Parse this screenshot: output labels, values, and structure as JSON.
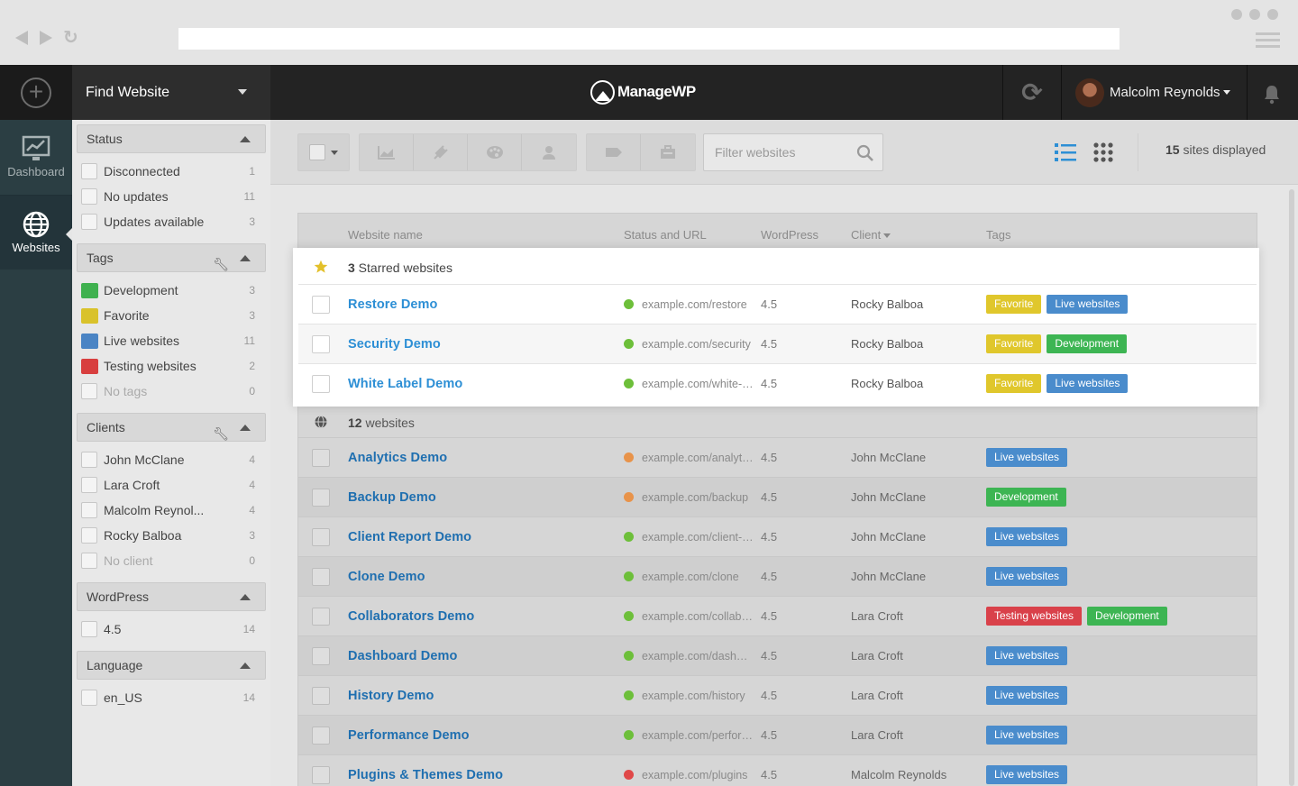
{
  "topbar": {
    "find_website": "Find Website",
    "logo_text": "ManageWP",
    "user_name": "Malcolm Reynolds"
  },
  "leftnav": {
    "dashboard_label": "Dashboard",
    "websites_label": "Websites"
  },
  "sidebar": {
    "status": {
      "title": "Status",
      "items": [
        {
          "label": "Disconnected",
          "count": "1"
        },
        {
          "label": "No updates",
          "count": "11"
        },
        {
          "label": "Updates available",
          "count": "3"
        }
      ]
    },
    "tags": {
      "title": "Tags",
      "items": [
        {
          "label": "Development",
          "count": "3",
          "color": "#3fb14f"
        },
        {
          "label": "Favorite",
          "count": "3",
          "color": "#d9c22b"
        },
        {
          "label": "Live websites",
          "count": "11",
          "color": "#4a84c4"
        },
        {
          "label": "Testing websites",
          "count": "2",
          "color": "#d83f3f"
        },
        {
          "label": "No tags",
          "count": "0"
        }
      ]
    },
    "clients": {
      "title": "Clients",
      "items": [
        {
          "label": "John McClane",
          "count": "4"
        },
        {
          "label": "Lara Croft",
          "count": "4"
        },
        {
          "label": "Malcolm Reynol...",
          "count": "4"
        },
        {
          "label": "Rocky Balboa",
          "count": "3"
        },
        {
          "label": "No client",
          "count": "0"
        }
      ]
    },
    "wordpress": {
      "title": "WordPress",
      "items": [
        {
          "label": "4.5",
          "count": "14"
        }
      ]
    },
    "language": {
      "title": "Language",
      "items": [
        {
          "label": "en_US",
          "count": "14"
        }
      ]
    }
  },
  "toolbar": {
    "filter_placeholder": "Filter websites",
    "sites_count": "15",
    "sites_count_suffix": " sites displayed"
  },
  "table": {
    "headers": {
      "name": "Website name",
      "status": "Status and URL",
      "wordpress": "WordPress",
      "client": "Client",
      "tags": "Tags"
    },
    "starred_group": {
      "count": "3",
      "label": " Starred websites"
    },
    "other_group": {
      "count": "12",
      "label": " websites"
    },
    "starred": [
      {
        "name": "Restore Demo",
        "url": "example.com/restore",
        "wp": "4.5",
        "client": "Rocky Balboa",
        "status": "green",
        "tags": [
          "Favorite",
          "Live websites"
        ]
      },
      {
        "name": "Security Demo",
        "url": "example.com/security",
        "wp": "4.5",
        "client": "Rocky Balboa",
        "status": "green",
        "tags": [
          "Favorite",
          "Development"
        ]
      },
      {
        "name": "White Label Demo",
        "url": "example.com/white-label",
        "wp": "4.5",
        "client": "Rocky Balboa",
        "status": "green",
        "tags": [
          "Favorite",
          "Live websites"
        ]
      }
    ],
    "rows": [
      {
        "name": "Analytics Demo",
        "url": "example.com/analytics",
        "wp": "4.5",
        "client": "John McClane",
        "status": "orange",
        "tags": [
          "Live websites"
        ]
      },
      {
        "name": "Backup Demo",
        "url": "example.com/backup",
        "wp": "4.5",
        "client": "John McClane",
        "status": "orange",
        "tags": [
          "Development"
        ]
      },
      {
        "name": "Client Report Demo",
        "url": "example.com/client-report",
        "wp": "4.5",
        "client": "John McClane",
        "status": "green",
        "tags": [
          "Live websites"
        ]
      },
      {
        "name": "Clone Demo",
        "url": "example.com/clone",
        "wp": "4.5",
        "client": "John McClane",
        "status": "green",
        "tags": [
          "Live websites"
        ]
      },
      {
        "name": "Collaborators Demo",
        "url": "example.com/collaborators",
        "wp": "4.5",
        "client": "Lara Croft",
        "status": "green",
        "tags": [
          "Testing websites",
          "Development"
        ]
      },
      {
        "name": "Dashboard Demo",
        "url": "example.com/dashboard",
        "wp": "4.5",
        "client": "Lara Croft",
        "status": "green",
        "tags": [
          "Live websites"
        ]
      },
      {
        "name": "History Demo",
        "url": "example.com/history",
        "wp": "4.5",
        "client": "Lara Croft",
        "status": "green",
        "tags": [
          "Live websites"
        ]
      },
      {
        "name": "Performance Demo",
        "url": "example.com/performance",
        "wp": "4.5",
        "client": "Lara Croft",
        "status": "green",
        "tags": [
          "Live websites"
        ]
      },
      {
        "name": "Plugins & Themes Demo",
        "url": "example.com/plugins",
        "wp": "4.5",
        "client": "Malcolm Reynolds",
        "status": "red",
        "tags": [
          "Live websites"
        ]
      }
    ]
  },
  "colors": {
    "tag_Favorite": "#e0c72c",
    "tag_Live websites": "#4a8ccc",
    "tag_Development": "#3db553",
    "tag_Testing websites": "#d9414a",
    "status_green": "#6dbf3a",
    "status_orange": "#e8934a",
    "status_red": "#e04848",
    "link": "#2d8fd5"
  }
}
